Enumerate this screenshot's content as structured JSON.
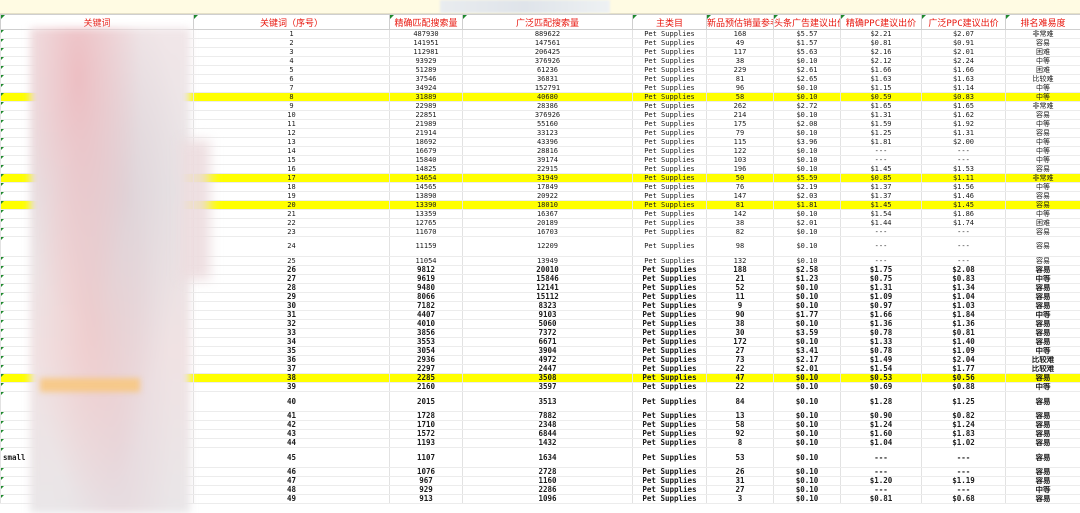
{
  "columns": [
    "关键词",
    "关键词（序号）",
    "精确匹配搜索量",
    "广泛匹配搜索量",
    "主类目",
    "新品预估销量参考",
    "头条广告建议出价",
    "精确PPC建议出价",
    "广泛PPC建议出价",
    "排名难易度"
  ],
  "rows": [
    {
      "kw": "",
      "seq": "1",
      "exact": "487930",
      "broad": "889622",
      "cat": "Pet Supplies",
      "new": "168",
      "head": "$5.57",
      "eppc": "$2.21",
      "bppc": "$2.07",
      "diff": "非常难"
    },
    {
      "kw": "",
      "seq": "2",
      "exact": "141951",
      "broad": "147561",
      "cat": "Pet Supplies",
      "new": "49",
      "head": "$1.57",
      "eppc": "$0.81",
      "bppc": "$0.91",
      "diff": "容易"
    },
    {
      "kw": "",
      "seq": "3",
      "exact": "112981",
      "broad": "206425",
      "cat": "Pet Supplies",
      "new": "117",
      "head": "$5.63",
      "eppc": "$2.16",
      "bppc": "$2.01",
      "diff": "困难"
    },
    {
      "kw": "",
      "seq": "4",
      "exact": "93929",
      "broad": "376926",
      "cat": "Pet Supplies",
      "new": "38",
      "head": "$0.10",
      "eppc": "$2.12",
      "bppc": "$2.24",
      "diff": "中等"
    },
    {
      "kw": "",
      "seq": "5",
      "exact": "51289",
      "broad": "61236",
      "cat": "Pet Supplies",
      "new": "229",
      "head": "$2.61",
      "eppc": "$1.66",
      "bppc": "$1.66",
      "diff": "困难"
    },
    {
      "kw": "",
      "seq": "6",
      "exact": "37546",
      "broad": "36831",
      "cat": "Pet Supplies",
      "new": "81",
      "head": "$2.65",
      "eppc": "$1.63",
      "bppc": "$1.63",
      "diff": "比较难"
    },
    {
      "kw": "",
      "seq": "7",
      "exact": "34924",
      "broad": "152791",
      "cat": "Pet Supplies",
      "new": "96",
      "head": "$0.10",
      "eppc": "$1.15",
      "bppc": "$1.14",
      "diff": "中等"
    },
    {
      "kw": "",
      "seq": "8",
      "exact": "31889",
      "broad": "40680",
      "cat": "Pet Supplies",
      "new": "58",
      "head": "$0.10",
      "eppc": "$0.59",
      "bppc": "$0.83",
      "diff": "中等",
      "hl": true
    },
    {
      "kw": "",
      "seq": "9",
      "exact": "22989",
      "broad": "28386",
      "cat": "Pet Supplies",
      "new": "262",
      "head": "$2.72",
      "eppc": "$1.65",
      "bppc": "$1.65",
      "diff": "非常难"
    },
    {
      "kw": "",
      "seq": "10",
      "exact": "22851",
      "broad": "376926",
      "cat": "Pet Supplies",
      "new": "214",
      "head": "$0.10",
      "eppc": "$1.31",
      "bppc": "$1.62",
      "diff": "容易"
    },
    {
      "kw": "",
      "seq": "11",
      "exact": "21989",
      "broad": "55160",
      "cat": "Pet Supplies",
      "new": "175",
      "head": "$2.08",
      "eppc": "$1.59",
      "bppc": "$1.92",
      "diff": "中等"
    },
    {
      "kw": "",
      "seq": "12",
      "exact": "21914",
      "broad": "33123",
      "cat": "Pet Supplies",
      "new": "79",
      "head": "$0.10",
      "eppc": "$1.25",
      "bppc": "$1.31",
      "diff": "容易"
    },
    {
      "kw": "",
      "seq": "13",
      "exact": "18692",
      "broad": "43396",
      "cat": "Pet Supplies",
      "new": "115",
      "head": "$3.96",
      "eppc": "$1.81",
      "bppc": "$2.00",
      "diff": "中等"
    },
    {
      "kw": "",
      "seq": "14",
      "exact": "16679",
      "broad": "28816",
      "cat": "Pet Supplies",
      "new": "122",
      "head": "$0.10",
      "eppc": "---",
      "bppc": "---",
      "diff": "中等"
    },
    {
      "kw": "",
      "seq": "15",
      "exact": "15840",
      "broad": "39174",
      "cat": "Pet Supplies",
      "new": "103",
      "head": "$0.10",
      "eppc": "---",
      "bppc": "---",
      "diff": "中等"
    },
    {
      "kw": "",
      "seq": "16",
      "exact": "14825",
      "broad": "22915",
      "cat": "Pet Supplies",
      "new": "196",
      "head": "$0.10",
      "eppc": "$1.45",
      "bppc": "$1.53",
      "diff": "容易"
    },
    {
      "kw": "",
      "seq": "17",
      "exact": "14654",
      "broad": "31949",
      "cat": "Pet Supplies",
      "new": "50",
      "head": "$5.59",
      "eppc": "$0.85",
      "bppc": "$1.11",
      "diff": "非常难",
      "hl": true
    },
    {
      "kw": "",
      "seq": "18",
      "exact": "14565",
      "broad": "17849",
      "cat": "Pet Supplies",
      "new": "76",
      "head": "$2.19",
      "eppc": "$1.37",
      "bppc": "$1.56",
      "diff": "中等"
    },
    {
      "kw": "",
      "seq": "19",
      "exact": "13890",
      "broad": "20922",
      "cat": "Pet Supplies",
      "new": "147",
      "head": "$2.03",
      "eppc": "$1.37",
      "bppc": "$1.46",
      "diff": "容易"
    },
    {
      "kw": "",
      "seq": "20",
      "exact": "13390",
      "broad": "18010",
      "cat": "Pet Supplies",
      "new": "81",
      "head": "$1.81",
      "eppc": "$1.45",
      "bppc": "$1.45",
      "diff": "容易",
      "hl": true
    },
    {
      "kw": "",
      "seq": "21",
      "exact": "13359",
      "broad": "16367",
      "cat": "Pet Supplies",
      "new": "142",
      "head": "$0.10",
      "eppc": "$1.54",
      "bppc": "$1.86",
      "diff": "中等"
    },
    {
      "kw": "",
      "seq": "22",
      "exact": "12765",
      "broad": "20189",
      "cat": "Pet Supplies",
      "new": "38",
      "head": "$2.01",
      "eppc": "$1.44",
      "bppc": "$1.74",
      "diff": "困难"
    },
    {
      "kw": "",
      "seq": "23",
      "exact": "11670",
      "broad": "16703",
      "cat": "Pet Supplies",
      "new": "82",
      "head": "$0.10",
      "eppc": "---",
      "bppc": "---",
      "diff": "容易"
    },
    {
      "kw": "",
      "seq": "24",
      "exact": "11159",
      "broad": "12209",
      "cat": "Pet Supplies",
      "new": "98",
      "head": "$0.10",
      "eppc": "---",
      "bppc": "---",
      "diff": "容易",
      "tall": true
    },
    {
      "kw": "",
      "seq": "25",
      "exact": "11054",
      "broad": "13949",
      "cat": "Pet Supplies",
      "new": "132",
      "head": "$0.10",
      "eppc": "---",
      "bppc": "---",
      "diff": "容易"
    },
    {
      "kw": "",
      "seq": "26",
      "exact": "9812",
      "broad": "20010",
      "cat": "Pet Supplies",
      "new": "188",
      "head": "$2.58",
      "eppc": "$1.75",
      "bppc": "$2.08",
      "diff": "容易",
      "bold": true
    },
    {
      "kw": "",
      "seq": "27",
      "exact": "9619",
      "broad": "15846",
      "cat": "Pet Supplies",
      "new": "21",
      "head": "$1.23",
      "eppc": "$0.75",
      "bppc": "$0.83",
      "diff": "中等",
      "bold": true
    },
    {
      "kw": "",
      "seq": "28",
      "exact": "9480",
      "broad": "12141",
      "cat": "Pet Supplies",
      "new": "52",
      "head": "$0.10",
      "eppc": "$1.31",
      "bppc": "$1.34",
      "diff": "容易",
      "bold": true
    },
    {
      "kw": "",
      "seq": "29",
      "exact": "8066",
      "broad": "15112",
      "cat": "Pet Supplies",
      "new": "11",
      "head": "$0.10",
      "eppc": "$1.09",
      "bppc": "$1.04",
      "diff": "容易",
      "bold": true
    },
    {
      "kw": "",
      "seq": "30",
      "exact": "7182",
      "broad": "8323",
      "cat": "Pet Supplies",
      "new": "9",
      "head": "$0.10",
      "eppc": "$0.97",
      "bppc": "$1.03",
      "diff": "容易",
      "bold": true
    },
    {
      "kw": "",
      "seq": "31",
      "exact": "4407",
      "broad": "9103",
      "cat": "Pet Supplies",
      "new": "90",
      "head": "$1.77",
      "eppc": "$1.66",
      "bppc": "$1.84",
      "diff": "中等",
      "bold": true
    },
    {
      "kw": "",
      "seq": "32",
      "exact": "4010",
      "broad": "5060",
      "cat": "Pet Supplies",
      "new": "38",
      "head": "$0.10",
      "eppc": "$1.36",
      "bppc": "$1.36",
      "diff": "容易",
      "bold": true
    },
    {
      "kw": "",
      "seq": "33",
      "exact": "3856",
      "broad": "7372",
      "cat": "Pet Supplies",
      "new": "30",
      "head": "$3.59",
      "eppc": "$0.78",
      "bppc": "$0.81",
      "diff": "容易",
      "bold": true
    },
    {
      "kw": "",
      "seq": "34",
      "exact": "3553",
      "broad": "6671",
      "cat": "Pet Supplies",
      "new": "172",
      "head": "$0.10",
      "eppc": "$1.33",
      "bppc": "$1.40",
      "diff": "容易",
      "bold": true
    },
    {
      "kw": "",
      "seq": "35",
      "exact": "3054",
      "broad": "3904",
      "cat": "Pet Supplies",
      "new": "27",
      "head": "$3.41",
      "eppc": "$0.78",
      "bppc": "$1.09",
      "diff": "中等",
      "bold": true
    },
    {
      "kw": "",
      "seq": "36",
      "exact": "2936",
      "broad": "4972",
      "cat": "Pet Supplies",
      "new": "73",
      "head": "$2.17",
      "eppc": "$1.49",
      "bppc": "$2.04",
      "diff": "比较难",
      "bold": true
    },
    {
      "kw": "",
      "seq": "37",
      "exact": "2297",
      "broad": "2447",
      "cat": "Pet Supplies",
      "new": "22",
      "head": "$2.01",
      "eppc": "$1.54",
      "bppc": "$1.77",
      "diff": "比较难",
      "bold": true
    },
    {
      "kw": "",
      "seq": "38",
      "exact": "2285",
      "broad": "3508",
      "cat": "Pet Supplies",
      "new": "47",
      "head": "$0.10",
      "eppc": "$0.53",
      "bppc": "$0.56",
      "diff": "容易",
      "bold": true,
      "hl": true
    },
    {
      "kw": "",
      "seq": "39",
      "exact": "2160",
      "broad": "3597",
      "cat": "Pet Supplies",
      "new": "22",
      "head": "$0.10",
      "eppc": "$0.69",
      "bppc": "$0.88",
      "diff": "中等",
      "bold": true
    },
    {
      "kw": "",
      "seq": "40",
      "exact": "2015",
      "broad": "3513",
      "cat": "Pet Supplies",
      "new": "84",
      "head": "$0.10",
      "eppc": "$1.28",
      "bppc": "$1.25",
      "diff": "容易",
      "bold": true,
      "tall": true
    },
    {
      "kw": "",
      "seq": "41",
      "exact": "1728",
      "broad": "7882",
      "cat": "Pet Supplies",
      "new": "13",
      "head": "$0.10",
      "eppc": "$0.90",
      "bppc": "$0.82",
      "diff": "容易",
      "bold": true
    },
    {
      "kw": "",
      "seq": "42",
      "exact": "1710",
      "broad": "2348",
      "cat": "Pet Supplies",
      "new": "58",
      "head": "$0.10",
      "eppc": "$1.24",
      "bppc": "$1.24",
      "diff": "容易",
      "bold": true
    },
    {
      "kw": "",
      "seq": "43",
      "exact": "1572",
      "broad": "6844",
      "cat": "Pet Supplies",
      "new": "92",
      "head": "$0.10",
      "eppc": "$1.60",
      "bppc": "$1.83",
      "diff": "容易",
      "bold": true
    },
    {
      "kw": "",
      "seq": "44",
      "exact": "1193",
      "broad": "1432",
      "cat": "Pet Supplies",
      "new": "8",
      "head": "$0.10",
      "eppc": "$1.04",
      "bppc": "$1.02",
      "diff": "容易",
      "bold": true
    },
    {
      "kw": "small",
      "seq": "45",
      "exact": "1107",
      "broad": "1634",
      "cat": "Pet Supplies",
      "new": "53",
      "head": "$0.10",
      "eppc": "---",
      "bppc": "---",
      "diff": "容易",
      "bold": true,
      "tall": true
    },
    {
      "kw": "",
      "seq": "46",
      "exact": "1076",
      "broad": "2728",
      "cat": "Pet Supplies",
      "new": "26",
      "head": "$0.10",
      "eppc": "---",
      "bppc": "---",
      "diff": "容易",
      "bold": true
    },
    {
      "kw": "",
      "seq": "47",
      "exact": "967",
      "broad": "1160",
      "cat": "Pet Supplies",
      "new": "31",
      "head": "$0.10",
      "eppc": "$1.20",
      "bppc": "$1.19",
      "diff": "容易",
      "bold": true
    },
    {
      "kw": "",
      "seq": "48",
      "exact": "929",
      "broad": "2286",
      "cat": "Pet Supplies",
      "new": "27",
      "head": "$0.10",
      "eppc": "---",
      "bppc": "---",
      "diff": "中等",
      "bold": true
    },
    {
      "kw": "",
      "seq": "49",
      "exact": "913",
      "broad": "1096",
      "cat": "Pet Supplies",
      "new": "3",
      "head": "$0.10",
      "eppc": "$0.81",
      "bppc": "$0.68",
      "diff": "容易",
      "bold": true
    }
  ]
}
